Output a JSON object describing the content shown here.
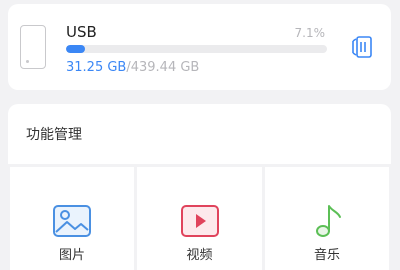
{
  "storage": {
    "device_name": "USB",
    "percent_text": "7.1%",
    "used_fraction": 0.071,
    "used": "31.25 GB",
    "separator": "/",
    "total": "439.44 GB"
  },
  "functions": {
    "title": "功能管理",
    "items": [
      {
        "label": "图片",
        "icon": "picture-icon"
      },
      {
        "label": "视频",
        "icon": "video-icon"
      },
      {
        "label": "音乐",
        "icon": "music-icon"
      }
    ]
  },
  "colors": {
    "accent": "#3b87f5",
    "picture": "#4a90e2",
    "video": "#e0435c",
    "music": "#5cbf56"
  }
}
